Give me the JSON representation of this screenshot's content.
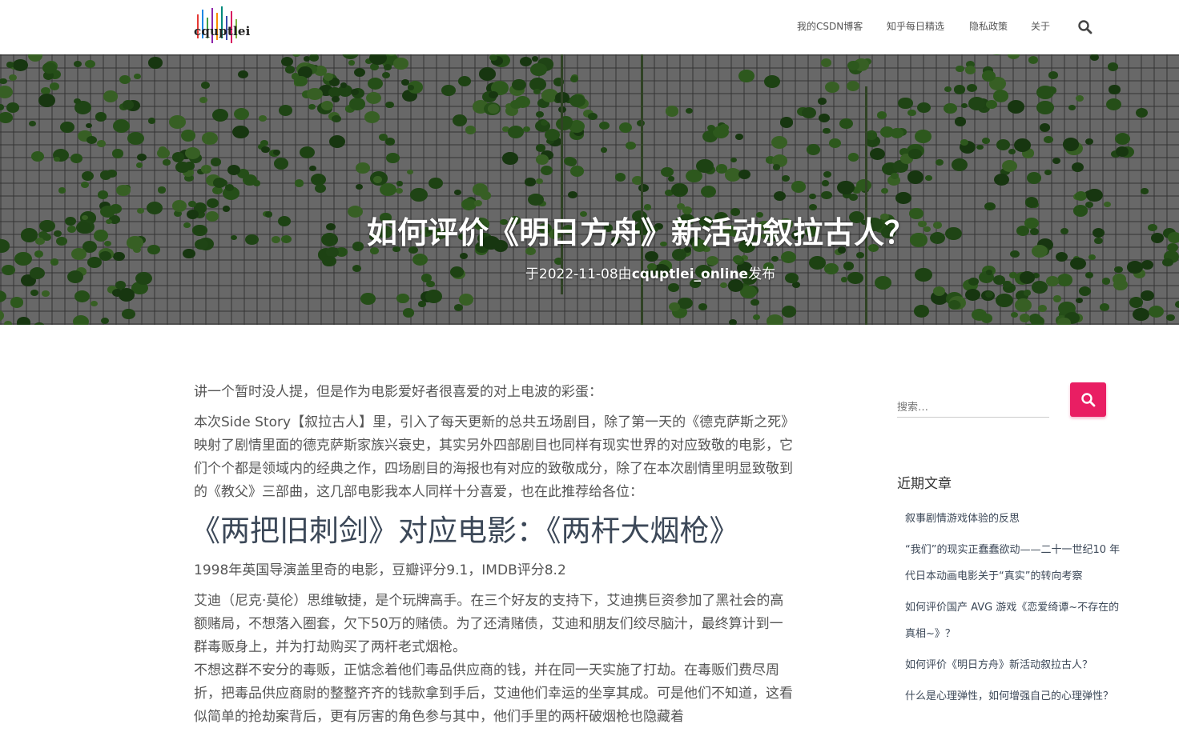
{
  "site": {
    "logo_text": "cquptlei"
  },
  "nav": {
    "items": [
      {
        "label": "我的CSDN博客"
      },
      {
        "label": "知乎每日精选"
      },
      {
        "label": "隐私政策"
      },
      {
        "label": "关于"
      }
    ],
    "search_icon": "search-icon"
  },
  "hero": {
    "title": "如何评价《明日方舟》新活动叙拉古人？",
    "meta_prefix": "于2022-11-08由",
    "author": "cquptlei_online",
    "meta_suffix": "发布"
  },
  "article": {
    "intro": "讲一个暂时没人提，但是作为电影爱好者很喜爱的对上电波的彩蛋：",
    "para1": "本次Side Story【叙拉古人】里，引入了每天更新的总共五场剧目，除了第一天的《德克萨斯之死》映射了剧情里面的德克萨斯家族兴衰史，其实另外四部剧目也同样有现实世界的对应致敬的电影，它们个个都是领域内的经典之作，四场剧目的海报也有对应的致敬成分，除了在本次剧情里明显致敬到的《教父》三部曲，这几部电影我本人同样十分喜爱，也在此推荐给各位：",
    "heading": "《两把旧刺剑》对应电影：《两杆大烟枪》",
    "movie_info": "1998年英国导演盖里奇的电影，豆瓣评分9.1，IMDB评分8.2",
    "synopsis1": "艾迪（尼克·莫伦）思维敏捷，是个玩牌高手。在三个好友的支持下，艾迪携巨资参加了黑社会的高额赌局，不想落入圈套，欠下50万的赌债。为了还清赌债，艾迪和朋友们绞尽脑汁，最终算计到一群毒贩身上，并为打劫购买了两杆老式烟枪。",
    "synopsis2": "不想这群不安分的毒贩，正惦念着他们毒品供应商的钱，并在同一天实施了打劫。在毒贩们费尽周折，把毒品供应商尉的整整齐齐的钱款拿到手后，艾迪他们幸运的坐享其成。可是他们不知道，这看似简单的抢劫案背后，更有厉害的角色参与其中，他们手里的两杆破烟枪也隐藏着"
  },
  "sidebar": {
    "search_placeholder": "搜索…",
    "recent_title": "近期文章",
    "recent_posts": [
      {
        "title": "叙事剧情游戏体验的反思"
      },
      {
        "title": "“我们”的现实正蠢蠢欲动——二十一世纪10 年代日本动画电影关于“真实”的转向考察"
      },
      {
        "title": "如何评价国产 AVG 游戏《恋爱绮谭~不存在的真相~》？"
      },
      {
        "title": "如何评价《明日方舟》新活动叙拉古人？"
      },
      {
        "title": "什么是心理弹性，如何增强自己的心理弹性？"
      }
    ]
  },
  "colors": {
    "accent": "#e91e63",
    "link": "#3c4858",
    "text": "#555555"
  }
}
